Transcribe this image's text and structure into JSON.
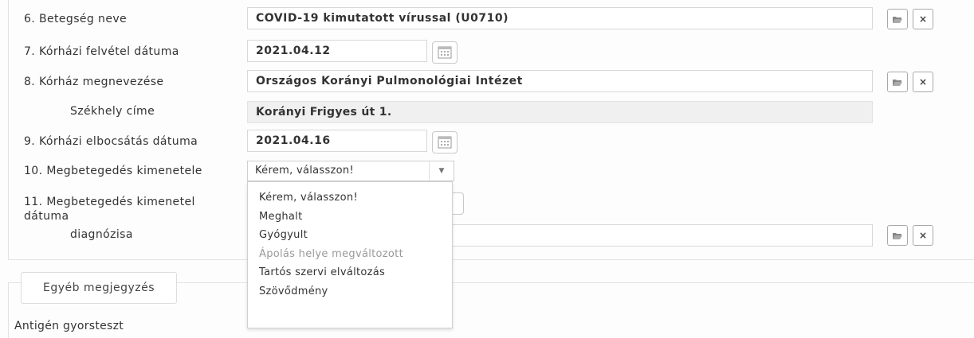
{
  "rows": {
    "disease": {
      "label": "6. Betegség neve",
      "value": "COVID-19 kimutatott vírussal  (U0710)"
    },
    "admission_date": {
      "label": "7. Kórházi felvétel dátuma",
      "value": "2021.04.12"
    },
    "hospital": {
      "label": "8. Kórház megnevezése",
      "value": "Országos Korányi Pulmonológiai Intézet"
    },
    "hq_address": {
      "label": "Székhely címe",
      "value": "Korányi Frigyes út 1."
    },
    "discharge_date": {
      "label": "9. Kórházi elbocsátás dátuma",
      "value": "2021.04.16"
    },
    "outcome": {
      "label": "10. Megbetegedés kimenetele",
      "value": "Kérem, válasszon!"
    },
    "outcome_date": {
      "label": "11. Megbetegedés kimenetel dátuma"
    },
    "diagnosis": {
      "label": "diagnózisa"
    }
  },
  "dropdown": {
    "options": [
      {
        "label": "Kérem, válasszon!",
        "disabled": false
      },
      {
        "label": "Meghalt",
        "disabled": false
      },
      {
        "label": "Gyógyult",
        "disabled": false
      },
      {
        "label": "Ápolás helye megváltozott",
        "disabled": true
      },
      {
        "label": "Tartós szervi elváltozás",
        "disabled": false
      },
      {
        "label": "Szövődmény",
        "disabled": false
      }
    ]
  },
  "section": {
    "tab_label": "Egyéb megjegyzés",
    "antigen_label": "Antigén gyorsteszt"
  },
  "icons": {
    "folder": "folder-open-icon",
    "clear": "close-icon",
    "calendar": "calendar-icon",
    "caret": "caret-down-icon"
  },
  "glyphs": {
    "clear": "×",
    "caret": "▼"
  }
}
